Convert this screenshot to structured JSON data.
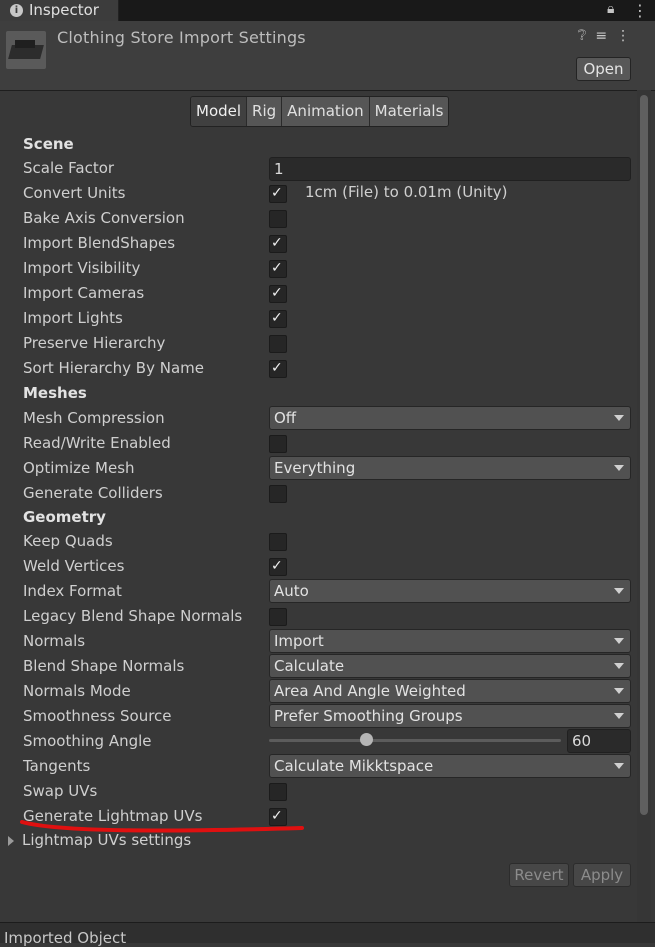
{
  "tab": {
    "title": "Inspector",
    "icon": "info-icon"
  },
  "header": {
    "title": "Clothing Store Import Settings",
    "open_label": "Open"
  },
  "mode_tabs": [
    "Model",
    "Rig",
    "Animation",
    "Materials"
  ],
  "active_tab": "Model",
  "sections": {
    "scene": "Scene",
    "meshes": "Meshes",
    "geometry": "Geometry"
  },
  "labels": {
    "scale_factor": "Scale Factor",
    "convert_units": "Convert Units",
    "bake_axis": "Bake Axis Conversion",
    "import_blendshapes": "Import BlendShapes",
    "import_visibility": "Import Visibility",
    "import_cameras": "Import Cameras",
    "import_lights": "Import Lights",
    "preserve_hierarchy": "Preserve Hierarchy",
    "sort_hierarchy": "Sort Hierarchy By Name",
    "mesh_compression": "Mesh Compression",
    "read_write": "Read/Write Enabled",
    "optimize_mesh": "Optimize Mesh",
    "generate_colliders": "Generate Colliders",
    "keep_quads": "Keep Quads",
    "weld_vertices": "Weld Vertices",
    "index_format": "Index Format",
    "legacy_blend": "Legacy Blend Shape Normals",
    "normals": "Normals",
    "blend_shape_normals": "Blend Shape Normals",
    "normals_mode": "Normals Mode",
    "smoothness_source": "Smoothness Source",
    "smoothing_angle": "Smoothing Angle",
    "tangents": "Tangents",
    "swap_uvs": "Swap UVs",
    "generate_lightmap": "Generate Lightmap UVs"
  },
  "values": {
    "scale_factor": "1",
    "convert_units_note": "1cm (File) to 0.01m (Unity)",
    "mesh_compression": "Off",
    "optimize_mesh": "Everything",
    "index_format": "Auto",
    "normals": "Import",
    "blend_shape_normals": "Calculate",
    "normals_mode": "Area And Angle Weighted",
    "smoothness_source": "Prefer Smoothing Groups",
    "smoothing_angle": "60",
    "smoothing_angle_fraction": 0.333,
    "tangents": "Calculate Mikktspace"
  },
  "checks": {
    "convert_units": true,
    "bake_axis": false,
    "import_blendshapes": true,
    "import_visibility": true,
    "import_cameras": true,
    "import_lights": true,
    "preserve_hierarchy": false,
    "sort_hierarchy": true,
    "read_write": false,
    "generate_colliders": false,
    "keep_quads": false,
    "weld_vertices": true,
    "legacy_blend": false,
    "swap_uvs": false,
    "generate_lightmap": true
  },
  "foldout": "Lightmap UVs settings",
  "buttons": {
    "revert": "Revert",
    "apply": "Apply"
  },
  "footer": "Imported Object",
  "colors": {
    "annotation": "#e01010",
    "panel": "#383838"
  }
}
